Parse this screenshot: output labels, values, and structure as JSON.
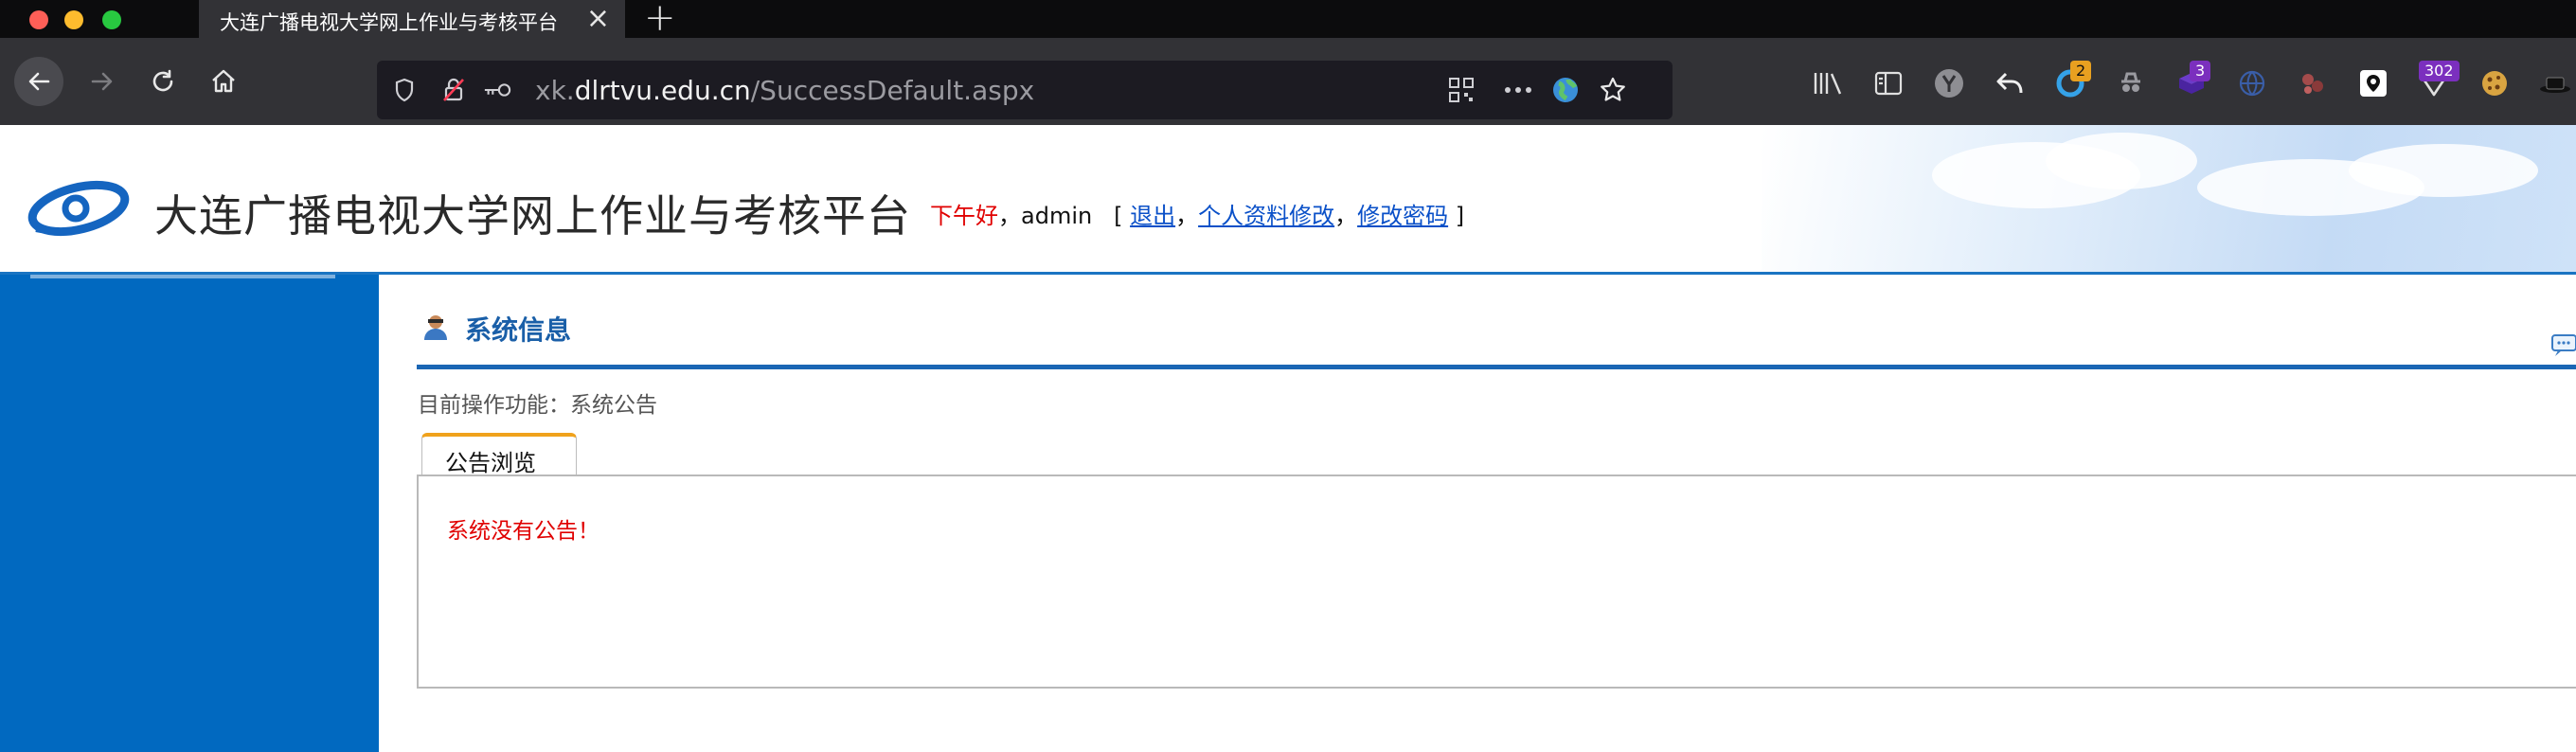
{
  "browser": {
    "tab_title": "大连广播电视大学网上作业与考核平台",
    "url_scheme_prefix": "xk.",
    "url_host": "dlrtvu.edu.cn",
    "url_path": "/SuccessDefault.aspx",
    "extensions": [
      {
        "name": "library-icon"
      },
      {
        "name": "sidebar-icon"
      },
      {
        "name": "y-extension-icon"
      },
      {
        "name": "undo-extension-icon"
      },
      {
        "name": "refresh-extension-icon",
        "badge": "2",
        "badge_color": "#e8a020"
      },
      {
        "name": "spy-extension-icon"
      },
      {
        "name": "cube-extension-icon",
        "badge": "3",
        "badge_color": "#7b2fbe"
      },
      {
        "name": "globe-extension-icon"
      },
      {
        "name": "dots-extension-icon"
      },
      {
        "name": "pin-extension-icon"
      },
      {
        "name": "filter-extension-icon",
        "badge": "302",
        "badge_color": "#7b2fbe"
      },
      {
        "name": "cookie-extension-icon"
      },
      {
        "name": "hat-extension-icon"
      }
    ]
  },
  "header": {
    "site_title": "大连广播电视大学网上作业与考核平台",
    "greeting": "下午好",
    "comma": "，",
    "username": "admin",
    "bracket_open": "[",
    "bracket_close": "]",
    "sep": "，",
    "links": {
      "logout": "退出",
      "profile": "个人资料修改",
      "password": "修改密码"
    }
  },
  "main": {
    "section_title": "系统信息",
    "breadcrumb_label": "目前操作功能：",
    "breadcrumb_value": "系统公告",
    "tab_label": "公告浏览",
    "empty_message": "系统没有公告！"
  },
  "colors": {
    "sidebar": "#0169c0",
    "accent_blue": "#1a66b4",
    "tab_accent": "#f0a21c",
    "alert_red": "#e00000"
  }
}
